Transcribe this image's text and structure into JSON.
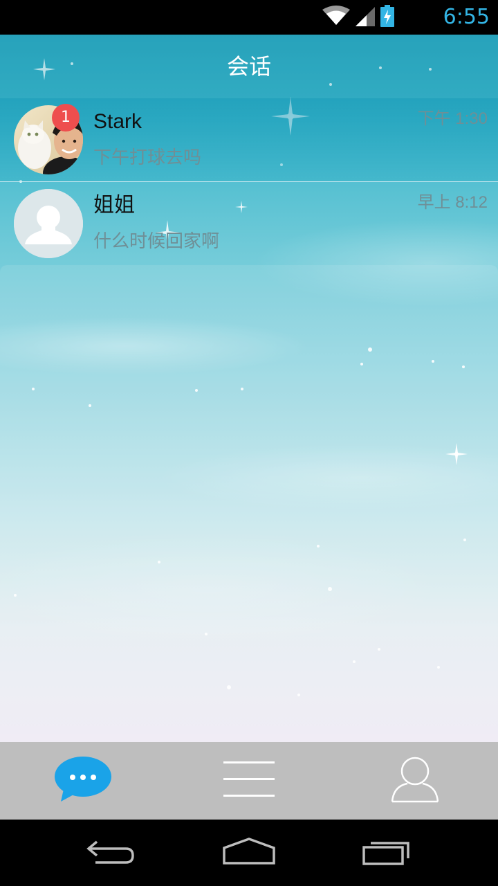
{
  "status_bar": {
    "time": "6:55",
    "icons": [
      "wifi-icon",
      "signal-icon",
      "battery-charging-icon"
    ],
    "time_color": "#33b5e5"
  },
  "header": {
    "title": "会话"
  },
  "conversations": [
    {
      "name": "Stark",
      "preview": "下午打球去吗",
      "time": "下午 1:30",
      "unread": "1",
      "avatar": "photo-avatar"
    },
    {
      "name": "姐姐",
      "preview": "什么时候回家啊",
      "time": "早上 8:12",
      "avatar": "default-avatar-icon"
    }
  ],
  "tabs": [
    {
      "icon": "chat-bubble-icon",
      "active": true
    },
    {
      "icon": "menu-lines-icon",
      "active": false
    },
    {
      "icon": "person-icon",
      "active": false
    }
  ],
  "nav": [
    "back-icon",
    "home-icon",
    "recent-apps-icon"
  ],
  "colors": {
    "accent": "#1aa3e8",
    "badge": "#ee4e4e",
    "tab_bar": "#bebebe",
    "secondary_text": "#6f8f96"
  }
}
